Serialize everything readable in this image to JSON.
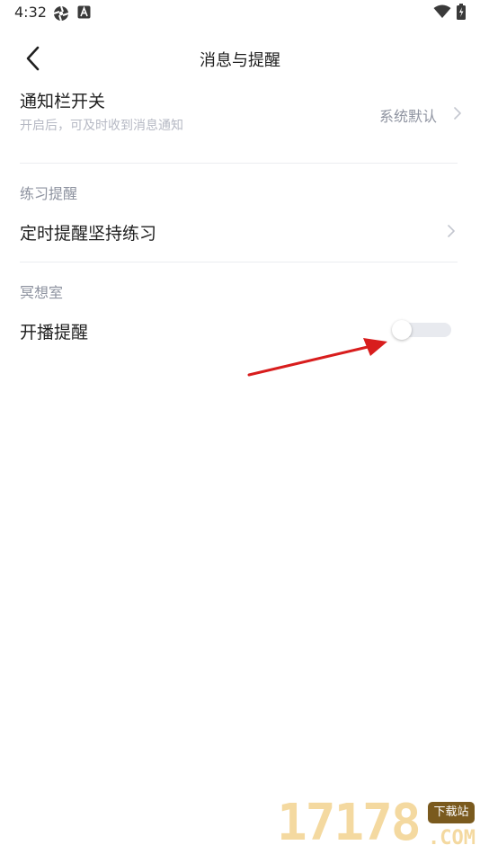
{
  "status_bar": {
    "time": "4:32",
    "icons": [
      "aperture-icon",
      "a-badge-icon",
      "wifi-icon",
      "battery-charging-icon"
    ]
  },
  "header": {
    "title": "消息与提醒",
    "back_icon": "chevron-left-icon"
  },
  "notification_switch": {
    "title": "通知栏开关",
    "subtitle": "开启后，可及时收到消息通知",
    "value": "系统默认"
  },
  "practice_section": {
    "label": "练习提醒",
    "item_title": "定时提醒坚持练习"
  },
  "meditation_section": {
    "label": "冥想室",
    "item_title": "开播提醒",
    "toggle_on": false
  },
  "annotation": {
    "arrow_color": "#d81d1d"
  },
  "watermark": {
    "digits": "17178",
    "badge": "下载站",
    "suffix": ".COM"
  },
  "colors": {
    "primary_text": "#1f1f1f",
    "secondary_text": "#8e93a0",
    "hint_text": "#b6b9c4",
    "divider": "#ebedf1",
    "toggle_track_off": "#e8eaef"
  }
}
